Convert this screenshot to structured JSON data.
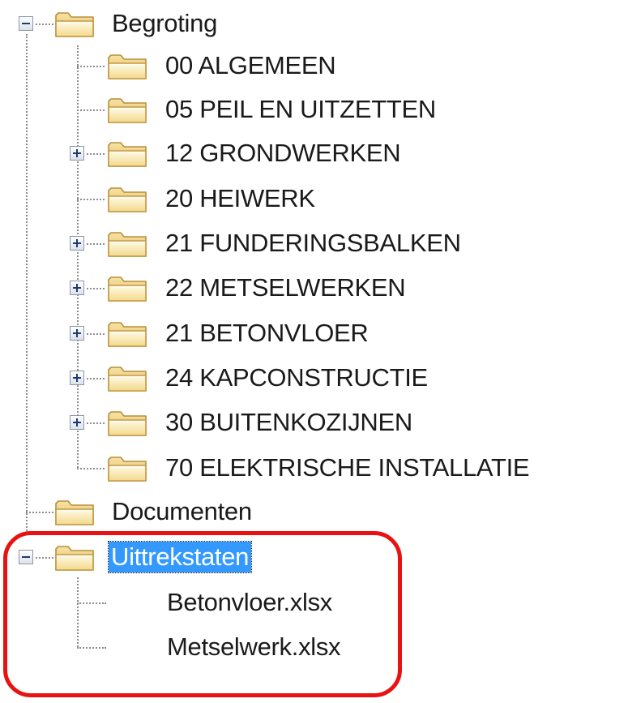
{
  "tree": {
    "root": {
      "label": "Begroting",
      "expanded": true,
      "children": [
        {
          "label": "00 ALGEMEEN",
          "expandable": false
        },
        {
          "label": "05 PEIL EN UITZETTEN",
          "expandable": false
        },
        {
          "label": "12 GRONDWERKEN",
          "expandable": true
        },
        {
          "label": "20 HEIWERK",
          "expandable": false
        },
        {
          "label": "21 FUNDERINGSBALKEN",
          "expandable": true
        },
        {
          "label": "22 METSELWERKEN",
          "expandable": true
        },
        {
          "label": "21 BETONVLOER",
          "expandable": true
        },
        {
          "label": "24 KAPCONSTRUCTIE",
          "expandable": true
        },
        {
          "label": "30 BUITENKOZIJNEN",
          "expandable": true
        },
        {
          "label": "70 ELEKTRISCHE INSTALLATIE",
          "expandable": false
        }
      ]
    },
    "documents": {
      "label": "Documenten"
    },
    "extracts": {
      "label": "Uittrekstaten",
      "selected": true,
      "expanded": true,
      "files": [
        {
          "label": "Betonvloer.xlsx"
        },
        {
          "label": "Metselwerk.xlsx"
        }
      ]
    }
  },
  "colors": {
    "selection": "#3399ff",
    "annotation": "#e81212",
    "folder": "#f4d88a"
  },
  "icons": {
    "folder": "folder-icon",
    "expand": "plus-icon",
    "collapse": "minus-icon"
  }
}
